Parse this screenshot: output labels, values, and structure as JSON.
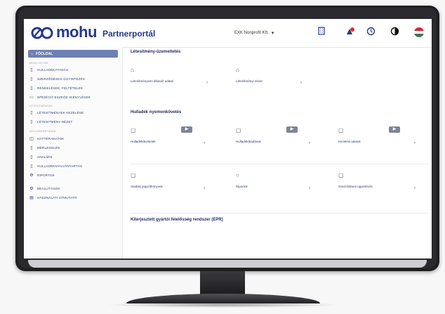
{
  "header": {
    "brand": "mohu",
    "brand_sub": "Partnerportál",
    "organization": "EXK Nonprofit Kft.",
    "icons": [
      "building-icon",
      "alert-icon",
      "history-icon",
      "contrast-icon",
      "language-flag-icon"
    ],
    "accent_color": "#263a8a"
  },
  "sidebar": {
    "home": "FŐOLDAL",
    "section_1": "MOHU ÜGYEK",
    "items_a": [
      "HULLADÉKÁTADÁS",
      "SZERZŐDÉSES ÜGYINTÉZÉS",
      "RENDELÉSEK, FELTÉTELEK",
      "SPEDÍCIÓ ESZKÖZ-IGÉNYLÉSEK"
    ],
    "section_2": "LÉTESÍTMÉNYEK",
    "items_b": [
      "LÉTESÍTMÉNYEK KEZELÉSE",
      "LÉTESÍTMÉNY-NÉZET"
    ],
    "section_3": "NYILVÁNTARTÁSOK",
    "items_c": [
      "HÁTTÉRADATOK",
      "MÉRLEGELÉS",
      "ANALÍZIS",
      "HULLADÉKNYILVÁNTARTÁS",
      "RIPORTOK"
    ],
    "items_d": [
      "BEÁLLÍTÁSOK",
      "HASZNÁLATI ÚTMUTATÓ"
    ]
  },
  "main": {
    "section_1_title": "Létesítmény-üzemeltetés",
    "section_1_cards": [
      {
        "label": "Létesítményeim állandó adatai",
        "icon": "facility-icon"
      },
      {
        "label": "Létesítményi nézet",
        "icon": "facility-view-icon"
      }
    ],
    "section_2_title": "Hulladék nyomonkövetés",
    "section_2_cards": [
      {
        "label": "Hulladékátvételek",
        "icon": "receipt-icon",
        "badge": "video-icon"
      },
      {
        "label": "Hulladékátadások",
        "icon": "handover-icon",
        "badge": "video-icon"
      },
      {
        "label": "Kezelési adatok",
        "icon": "document-icon",
        "badge": "video-icon"
      },
      {
        "label": "Átadási jegyzőkönyvek",
        "icon": "report-icon"
      },
      {
        "label": "Riportok",
        "icon": "chart-icon"
      },
      {
        "label": "Szerződéses ügyintézés",
        "icon": "contract-icon"
      }
    ],
    "section_3_title": "Kiterjesztett gyártói felelősség rendszer (EPR)"
  }
}
